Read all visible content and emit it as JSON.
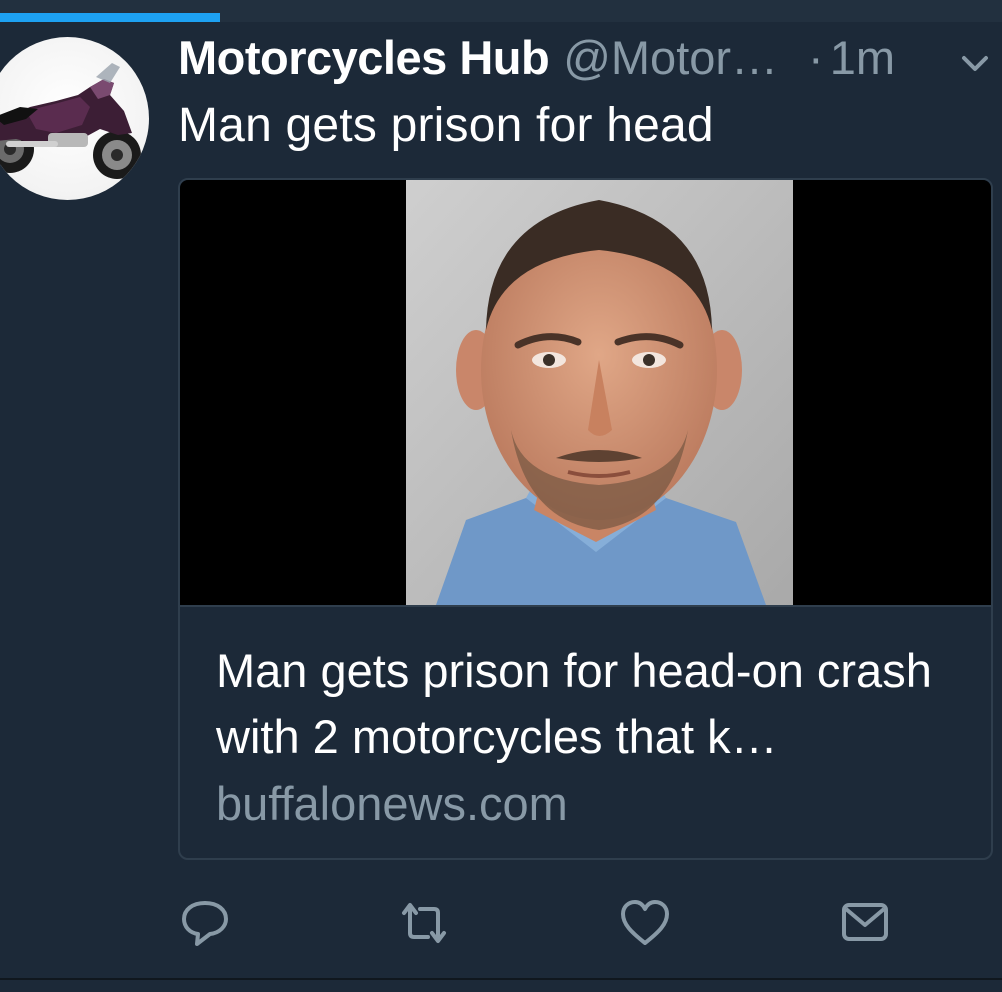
{
  "progress": {
    "fraction": 0.22
  },
  "colors": {
    "background": "#1c2938",
    "accent": "#1da1f2",
    "secondary_text": "#8899a6",
    "border": "#2f3e4d"
  },
  "tweet": {
    "display_name": "Motorcycles Hub",
    "handle": "@Motor…",
    "separator": "·",
    "time": "1m",
    "text": "Man gets prison for head",
    "avatar_icon": "motorcycle-avatar",
    "menu_icon": "chevron-down-icon"
  },
  "card": {
    "title": "Man gets prison for head-on crash with 2 motorcycles that k…",
    "domain": "buffalonews.com",
    "image": "mugshot-photo"
  },
  "actions": [
    {
      "name": "reply",
      "icon": "reply-icon"
    },
    {
      "name": "retweet",
      "icon": "retweet-icon"
    },
    {
      "name": "like",
      "icon": "heart-icon"
    },
    {
      "name": "direct-message",
      "icon": "envelope-icon"
    }
  ]
}
